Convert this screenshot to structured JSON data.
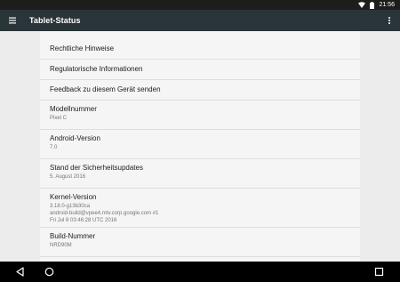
{
  "status_bar": {
    "time": "21:56",
    "icons": [
      "wifi-icon",
      "battery-icon"
    ]
  },
  "app_bar": {
    "title": "Tablet-Status",
    "menu_icon": "hamburger-menu-icon",
    "overflow_icon": "more-vert-icon"
  },
  "items": [
    {
      "title": "Rechtliche Hinweise"
    },
    {
      "title": "Regulatorische Informationen"
    },
    {
      "title": "Feedback zu diesem Gerät senden"
    },
    {
      "title": "Modellnummer",
      "value": "Pixel C"
    },
    {
      "title": "Android-Version",
      "value": "7.0"
    },
    {
      "title": "Stand der Sicherheitsupdates",
      "value": "5. August 2016"
    },
    {
      "title": "Kernel-Version",
      "lines": [
        "3.18.0-g13b30ca",
        "android-build@vpee4.mtv.corp.google.com #1",
        "Fri Jul 8 03:46:28 UTC 2016"
      ]
    },
    {
      "title": "Build-Nummer",
      "value": "NRD90M"
    }
  ],
  "nav_bar": {
    "back_icon": "back-icon",
    "home_icon": "home-icon",
    "recents_icon": "recents-icon"
  },
  "colors": {
    "status_bar": "#1d1d1d",
    "app_bar": "#2a353a",
    "background": "#ececec",
    "card": "#f5f5f5",
    "nav_bar": "#000000"
  }
}
